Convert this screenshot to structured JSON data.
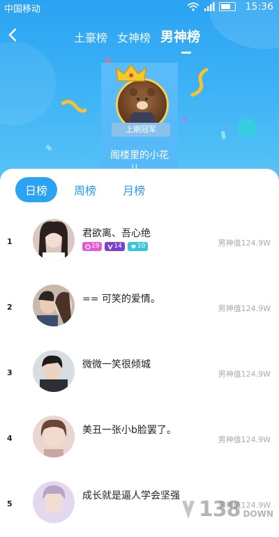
{
  "status_bar": {
    "carrier": "中国移动",
    "time": "15:36"
  },
  "header": {
    "tabs": [
      {
        "label": "土豪榜",
        "active": false
      },
      {
        "label": "女神榜",
        "active": false
      },
      {
        "label": "男神榜",
        "active": true
      }
    ]
  },
  "champion": {
    "ribbon": "上期冠军",
    "name": "阁楼里的小花儿。"
  },
  "period_tabs": [
    {
      "label": "日榜",
      "active": true
    },
    {
      "label": "周榜",
      "active": false
    },
    {
      "label": "月榜",
      "active": false
    }
  ],
  "rankings": [
    {
      "rank": "1",
      "name": "君欲离、吾心绝",
      "score": "男神值124.9W",
      "badges": [
        {
          "icon": "heart-icon",
          "value": "19",
          "color": "#e45bd6"
        },
        {
          "icon": "v-icon",
          "value": "14",
          "color": "#7b3fd0"
        },
        {
          "icon": "diamond-icon",
          "value": "10",
          "color": "#39c4e0"
        }
      ]
    },
    {
      "rank": "2",
      "name": "== 可笑的爱情。",
      "score": "男神值124.9W",
      "badges": []
    },
    {
      "rank": "3",
      "name": "微微一笑很倾城",
      "score": "男神值124.9W",
      "badges": []
    },
    {
      "rank": "4",
      "name": "美丑一张小b脸罢了。",
      "score": "男神值124.9W",
      "badges": []
    },
    {
      "rank": "5",
      "name": "成长就是逼人学会坚强",
      "score": "男神值124.9W",
      "badges": []
    }
  ],
  "watermark": {
    "number": "138",
    "suffix": "DOWN"
  },
  "colors": {
    "primary": "#2aa3f2",
    "gold": "#f3d35b",
    "muted": "#aaaaaa"
  }
}
